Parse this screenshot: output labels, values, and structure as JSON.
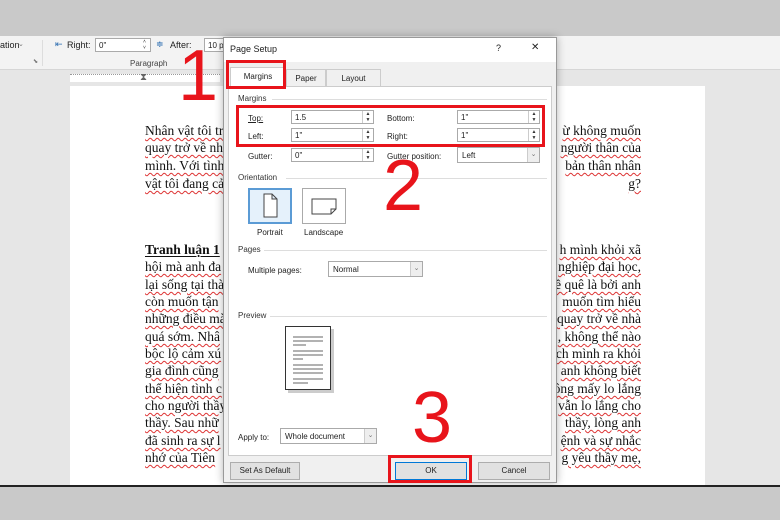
{
  "ribbon": {
    "indentation_label": "ation",
    "right_label": "Right:",
    "right_value": "0\"",
    "after_label": "After:",
    "after_value": "10 p",
    "group_label": "Paragraph"
  },
  "document": {
    "left_lines": [
      "Nhân vật tôi tr",
      "quay trở về nh",
      "mình. Với tình",
      "vật tôi đang cả",
      "Tranh luận 1",
      "hội mà anh đa",
      "lại sống tại thà",
      "còn muốn tận",
      "những điều mà",
      "quá sớm. Nhâ",
      "bộc lộ cảm xú",
      "gia đình cũng",
      "thể hiện tình c",
      "cho người thầy",
      "thầy. Sau nhữ",
      "đã sinh ra sự l",
      "nhớ của Tiên"
    ],
    "right_lines": [
      "ừ không muốn",
      "người thân của",
      "bản thân nhân",
      "g?",
      "h mình khỏi xã",
      "nghiệp đại học,",
      "ề quê là bởi anh",
      "muốn tìm hiểu",
      "quay trở về nhà",
      ", không thể nào",
      "ch mình ra khỏi",
      "anh không biết",
      "ông mấy lo lắng",
      "vẫn lo lắng cho",
      "thầy, lòng anh",
      "ệnh và sự nhắc",
      "g yêu thầy mẹ,"
    ]
  },
  "dialog": {
    "title": "Page Setup",
    "help": "?",
    "close": "✕",
    "tabs": [
      {
        "label": "Margins",
        "active": true
      },
      {
        "label": "Paper"
      },
      {
        "label": "Layout"
      }
    ],
    "margins_section": "Margins",
    "top_label": "Top:",
    "top_value": "1.5",
    "bottom_label": "Bottom:",
    "bottom_value": "1\"",
    "left_label": "Left:",
    "left_value": "1\"",
    "right_label": "Right:",
    "right_value": "1\"",
    "gutter_label": "Gutter:",
    "gutter_value": "0\"",
    "gutter_position_label": "Gutter position:",
    "gutter_position_value": "Left",
    "orientation_section": "Orientation",
    "portrait": "Portrait",
    "landscape": "Landscape",
    "orientation_selected": "Portrait",
    "pages_section": "Pages",
    "multiple_pages_label": "Multiple pages:",
    "multiple_pages_value": "Normal",
    "preview_section": "Preview",
    "apply_to_label": "Apply to:",
    "apply_to_value": "Whole document",
    "set_default": "Set As Default",
    "ok": "OK",
    "cancel": "Cancel"
  },
  "annotations": {
    "step1": "1",
    "step2": "2",
    "step3": "3",
    "color": "#e8141b"
  }
}
